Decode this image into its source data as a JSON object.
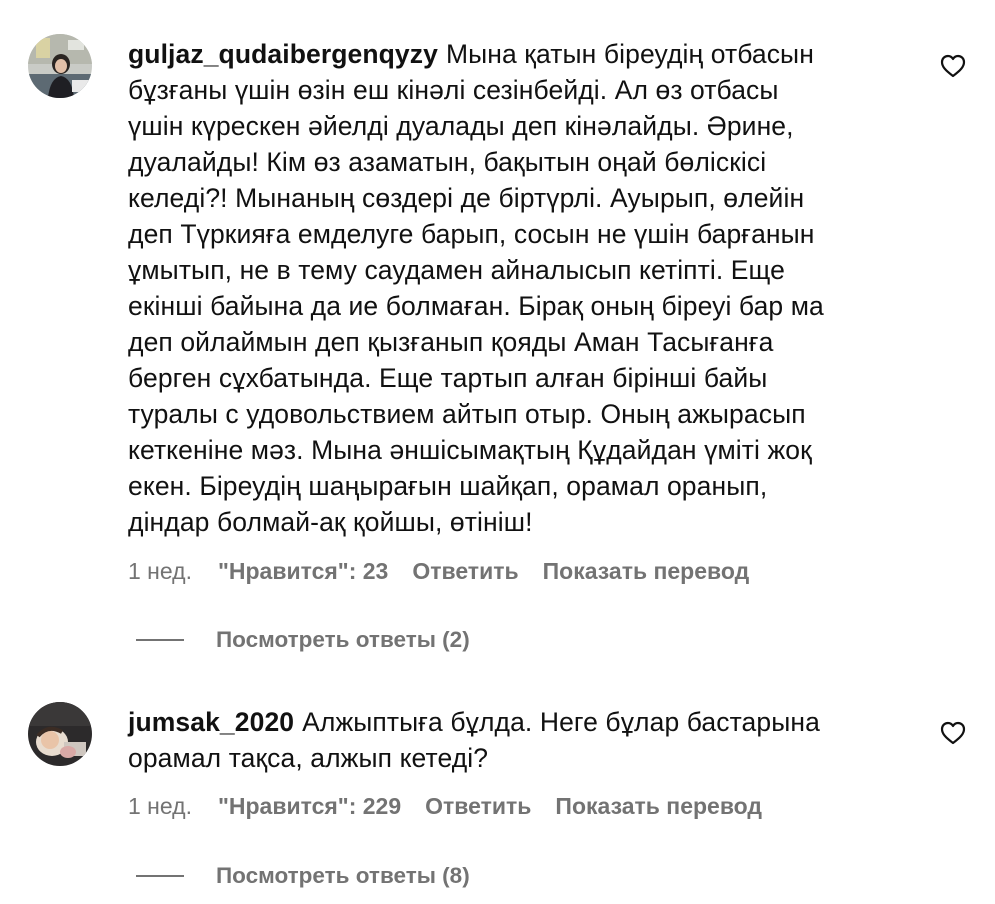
{
  "comments": [
    {
      "username": "guljaz_qudaibergenqyzy",
      "avatar_icon": "avatar-photo-woman-office",
      "text_lines": [
        "Мына қатын біреудің отбасын",
        "бұзғаны үшін өзін еш кінәлі сезінбейді. Ал өз отбасы",
        "үшін күрескен әйелді дуалады деп кінәлайды. Әрине,",
        "дуалайды! Кім өз азаматын, бақытын оңай бөлiскiсi",
        "келеді?! Мынаның сөздері де біртүрлі. Ауырып, өлейін",
        "деп Түркияға емделуге барып, сосын не үшін барғанын",
        "ұмытып, не в тему саудамен айналысып кетіпті. Еще",
        "екінші байына да ие болмаған. Бірақ оның біреуі бар ма",
        "деп ойлаймын деп қызғанып қояды Аман Тасығанға",
        "берген сұхбатында. Еще тартып алған бірінші байы",
        "туралы с удовольствием айтып отыр. Оның ажырасып",
        "кеткеніне мәз. Мына әншісымақтың Құдайдан үміті жоқ",
        "екен. Біреудің шаңырағын шайқап, орамал оранып,",
        "діндар болмай-ақ қойшы, өтініш!"
      ],
      "time": "1 нед.",
      "likes": "\"Нравится\": 23",
      "reply_label": "Ответить",
      "translate_label": "Показать перевод",
      "view_replies": "Посмотреть ответы (2)"
    },
    {
      "username": "jumsak_2020",
      "avatar_icon": "avatar-photo-child",
      "text_lines": [
        "Алжыптыға бұлда. Неге бұлар бастарына",
        "орамал тақса, алжып кетеді?"
      ],
      "time": "1 нед.",
      "likes": "\"Нравится\": 229",
      "reply_label": "Ответить",
      "translate_label": "Показать перевод",
      "view_replies": "Посмотреть ответы (8)"
    }
  ],
  "colors": {
    "text": "#111111",
    "secondary": "#737373",
    "background": "#ffffff"
  },
  "icons": {
    "like": "heart-outline-icon"
  }
}
